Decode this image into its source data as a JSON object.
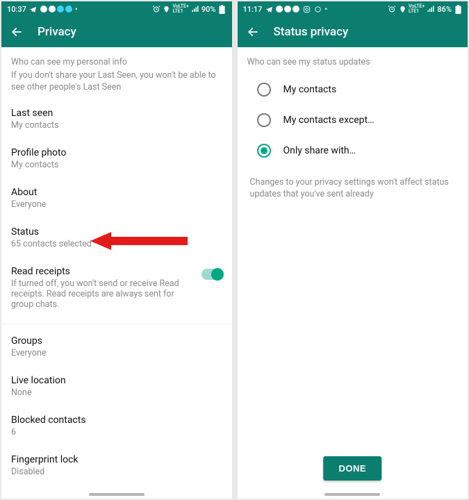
{
  "left": {
    "statusbar": {
      "time": "10:37",
      "battery": "90%",
      "net": "VoLTE+\nLTE1"
    },
    "title": "Privacy",
    "whoHeader": "Who can see my personal info",
    "whoDesc": "If you don't share your Last Seen, you won't be able to see other people's Last Seen",
    "items": {
      "lastSeen": {
        "title": "Last seen",
        "sub": "My contacts"
      },
      "profilePhoto": {
        "title": "Profile photo",
        "sub": "My contacts"
      },
      "about": {
        "title": "About",
        "sub": "Everyone"
      },
      "status": {
        "title": "Status",
        "sub": "65 contacts selected"
      },
      "readReceipts": {
        "title": "Read receipts",
        "sub": "If turned off, you won't send or receive Read receipts. Read receipts are always sent for group chats."
      },
      "groups": {
        "title": "Groups",
        "sub": "Everyone"
      },
      "liveLocation": {
        "title": "Live location",
        "sub": "None"
      },
      "blocked": {
        "title": "Blocked contacts",
        "sub": "6"
      },
      "fingerprint": {
        "title": "Fingerprint lock",
        "sub": "Disabled"
      }
    }
  },
  "right": {
    "statusbar": {
      "time": "11:17",
      "battery": "86%",
      "net": "VoLTE+\nLTE1"
    },
    "title": "Status privacy",
    "whoHeader": "Who can see my status updates",
    "options": {
      "a": "My contacts",
      "b": "My contacts except…",
      "c": "Only share with…"
    },
    "footnote": "Changes to your privacy settings won't affect status updates that you've sent already",
    "done": "DONE"
  }
}
